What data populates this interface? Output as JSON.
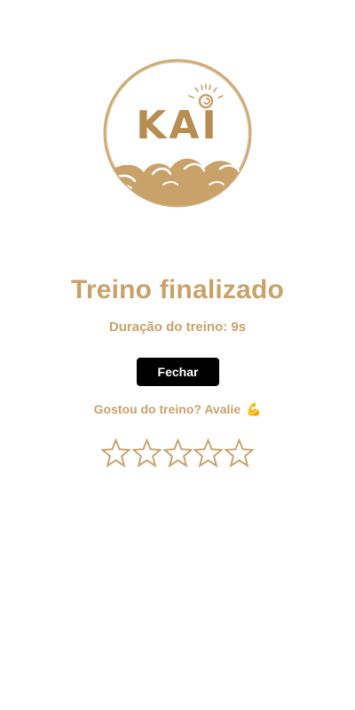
{
  "logo": {
    "text": "KAI",
    "colors": {
      "primary": "#c9a26a",
      "dark": "#b88d52"
    }
  },
  "summary": {
    "title": "Treino finalizado",
    "duration_text": "Duração do treino: 9s"
  },
  "actions": {
    "close_label": "Fechar"
  },
  "rating": {
    "prompt": "Gostou do treino? Avalie",
    "prompt_emoji": "💪",
    "stars_total": 5,
    "stars_filled": 0,
    "star_icon": "star-outline-icon"
  },
  "colors": {
    "accent": "#c9a26a",
    "button_bg": "#000000",
    "button_text": "#ffffff",
    "background": "#ffffff"
  }
}
